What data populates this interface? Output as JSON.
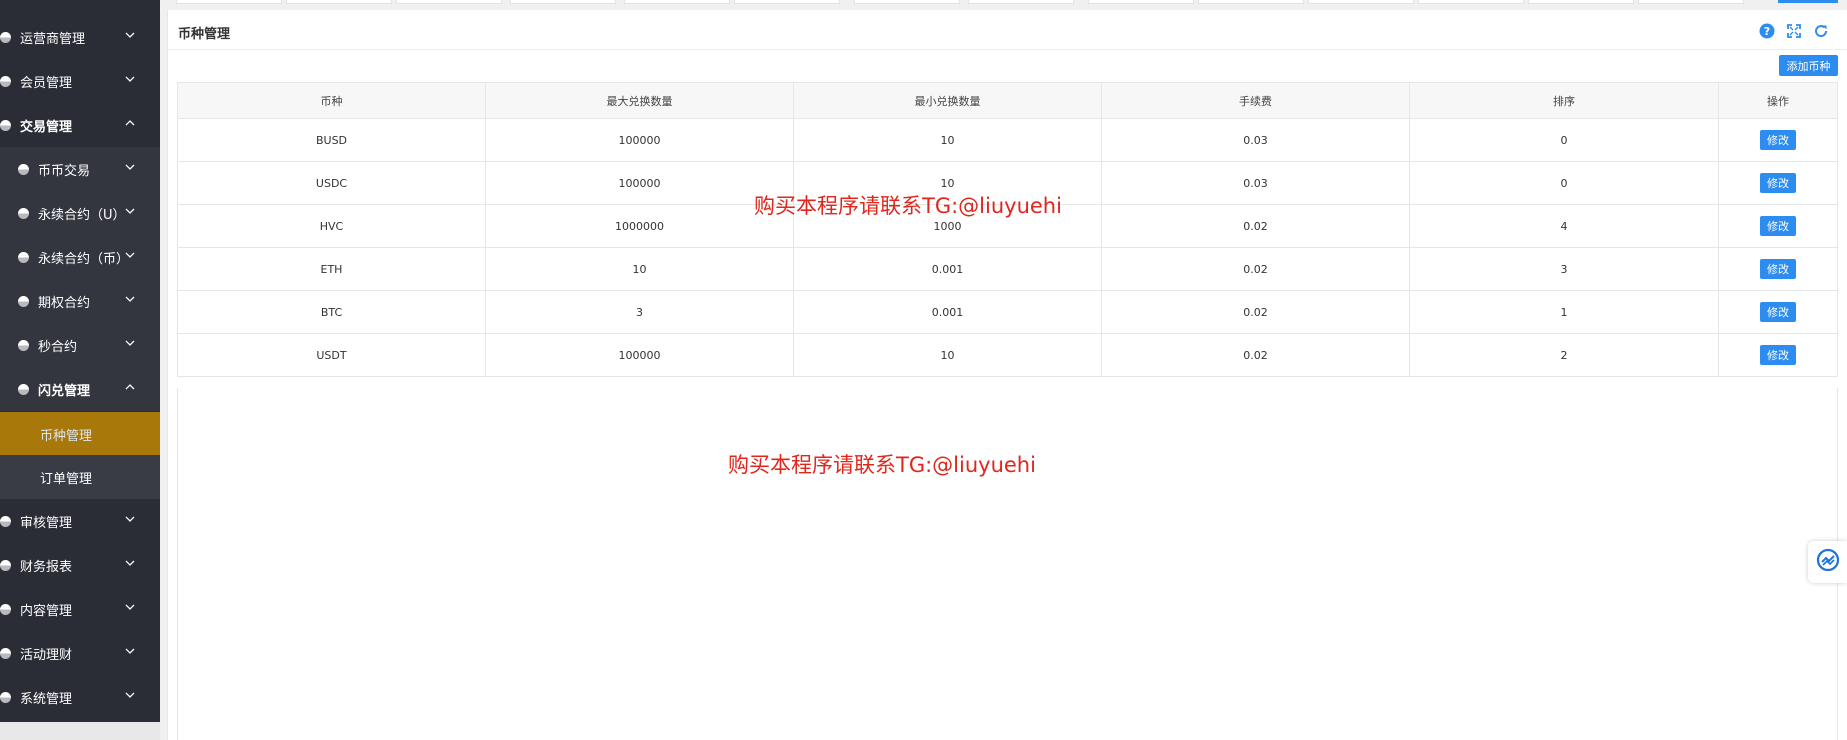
{
  "sidebar": {
    "items": [
      {
        "label": "运营商管理",
        "expanded": false
      },
      {
        "label": "会员管理",
        "expanded": false
      },
      {
        "label": "交易管理",
        "expanded": true
      },
      {
        "label": "币币交易",
        "expanded": false
      },
      {
        "label": "永续合约（U）",
        "expanded": false
      },
      {
        "label": "永续合约（币）",
        "expanded": false
      },
      {
        "label": "期权合约",
        "expanded": false
      },
      {
        "label": "秒合约",
        "expanded": false
      },
      {
        "label": "闪兑管理",
        "expanded": true
      },
      {
        "label": "币种管理",
        "active": true
      },
      {
        "label": "订单管理"
      },
      {
        "label": "审核管理",
        "expanded": false
      },
      {
        "label": "财务报表",
        "expanded": false
      },
      {
        "label": "内容管理",
        "expanded": false
      },
      {
        "label": "活动理财",
        "expanded": false
      },
      {
        "label": "系统管理",
        "expanded": false
      }
    ]
  },
  "header": {
    "title": "币种管理",
    "icons": [
      "help-icon",
      "fullscreen-icon",
      "refresh-icon"
    ]
  },
  "toolbar": {
    "add_label": "添加币种"
  },
  "table": {
    "columns": [
      "币种",
      "最大兑换数量",
      "最小兑换数量",
      "手续费",
      "排序",
      "操作"
    ],
    "rows": [
      [
        "BUSD",
        "100000",
        "10",
        "0.03",
        "0"
      ],
      [
        "USDC",
        "100000",
        "10",
        "0.03",
        "0"
      ],
      [
        "HVC",
        "1000000",
        "1000",
        "0.02",
        "4"
      ],
      [
        "ETH",
        "10",
        "0.001",
        "0.02",
        "3"
      ],
      [
        "BTC",
        "3",
        "0.001",
        "0.02",
        "1"
      ],
      [
        "USDT",
        "100000",
        "10",
        "0.02",
        "2"
      ]
    ],
    "action_label": "修改"
  },
  "watermarks": [
    "购买本程序请联系TG:@liuyuehi",
    "购买本程序请联系TG:@liuyuehi"
  ],
  "colors": {
    "sidebar_bg": "#2a2d35",
    "active_bg": "#a8780b",
    "primary": "#2d8cf0",
    "watermark": "#e0271e"
  }
}
